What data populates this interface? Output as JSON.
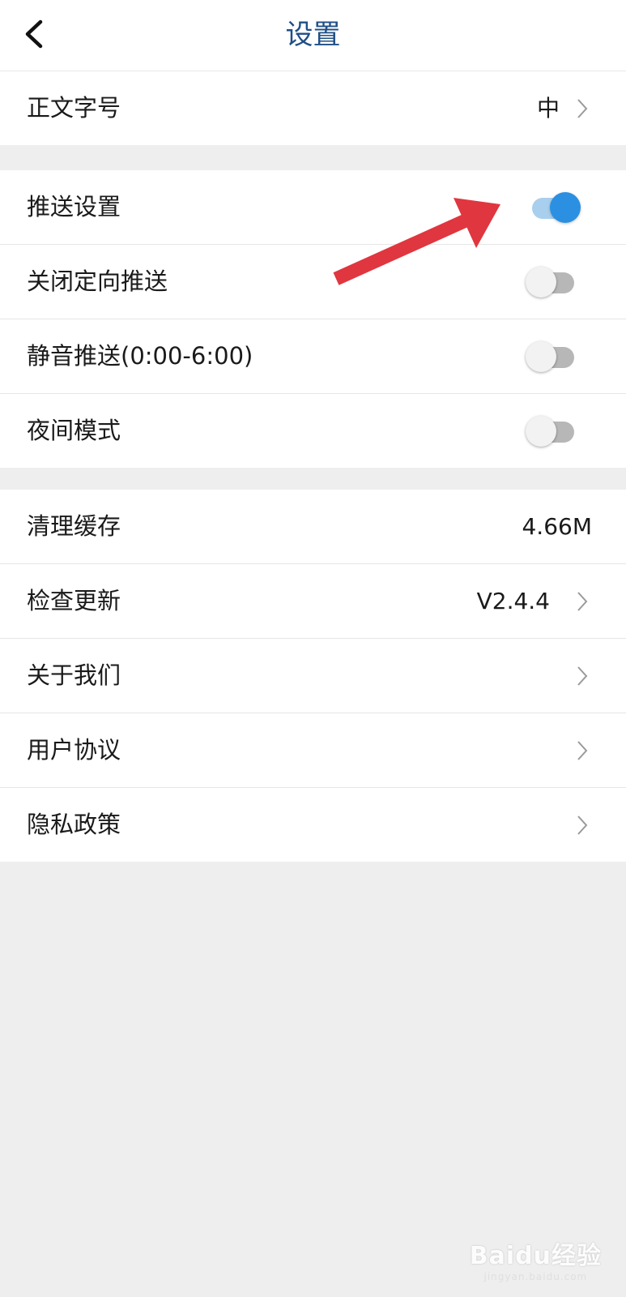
{
  "header": {
    "title": "设置"
  },
  "font_group": {
    "items": [
      {
        "label": "正文字号",
        "value": "中"
      }
    ]
  },
  "push_group": {
    "items": [
      {
        "label": "推送设置",
        "enabled": true
      },
      {
        "label": "关闭定向推送",
        "enabled": false
      },
      {
        "label": "静音推送(0:00-6:00)",
        "enabled": false
      },
      {
        "label": "夜间模式",
        "enabled": false
      }
    ]
  },
  "other_group": {
    "items": [
      {
        "label": "清理缓存",
        "value": "4.66M"
      },
      {
        "label": "检查更新",
        "value": "V2.4.4"
      },
      {
        "label": "关于我们"
      },
      {
        "label": "用户协议"
      },
      {
        "label": "隐私政策"
      }
    ]
  },
  "watermark": {
    "text": "Baidu经验",
    "sub": "jingyan.baidu.com"
  },
  "colors": {
    "title": "#1f4f86",
    "toggle_on": "#2b90e2",
    "toggle_on_track": "#a9cfee",
    "toggle_off_track": "#b7b7b7",
    "arrow": "#e0363f",
    "background": "#eeeeee"
  },
  "icons": {
    "back": "back-arrow-icon",
    "chevron": "chevron-right-icon"
  }
}
